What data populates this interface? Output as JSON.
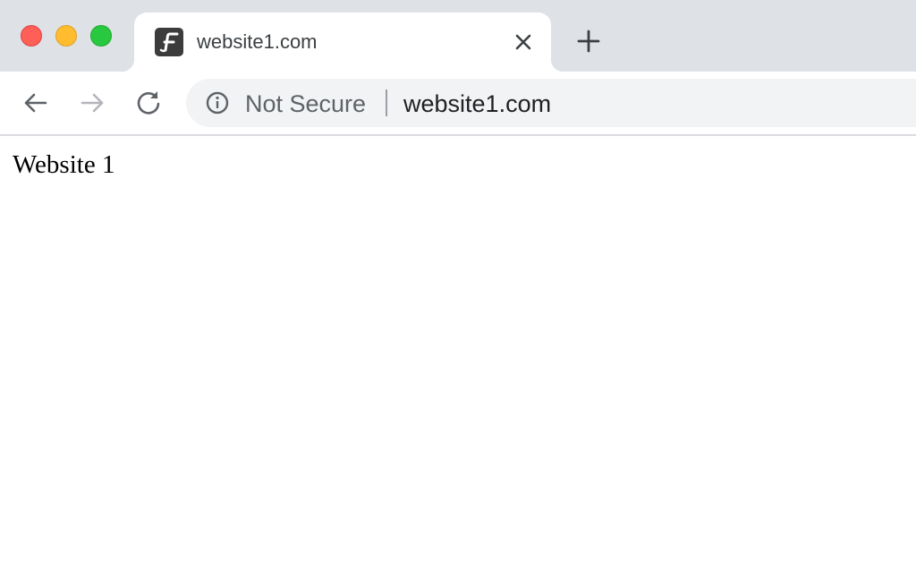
{
  "window": {
    "traffic_lights": {
      "close": "#fe5f57",
      "minimize": "#febc2e",
      "maximize": "#28c840"
    }
  },
  "tab": {
    "favicon": "f-logo-icon",
    "title": "website1.com",
    "close_icon": "close-icon"
  },
  "new_tab_icon": "plus-icon",
  "toolbar": {
    "back_icon": "arrow-left-icon",
    "forward_icon": "arrow-right-icon",
    "reload_icon": "reload-icon"
  },
  "omnibox": {
    "security_icon": "info-icon",
    "security_label": "Not Secure",
    "url": "website1.com"
  },
  "page": {
    "heading": "Website 1"
  }
}
